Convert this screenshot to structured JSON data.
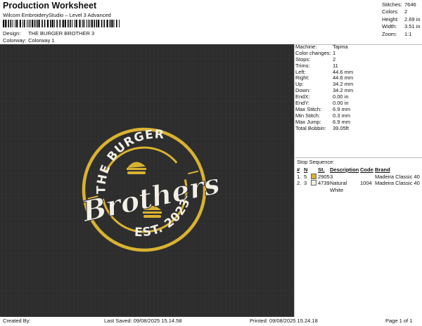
{
  "header": {
    "title": "Production Worksheet",
    "subtitle": "Wilcom EmbroideryStudio – Level 3 Advanced",
    "design_label": "Design:",
    "design_value": "THE BURGER BROTHER 3",
    "colorway_label": "Colorway:",
    "colorway_value": "Colorway 1"
  },
  "stats": [
    {
      "label": "Stitches:",
      "value": "7646"
    },
    {
      "label": "Colors:",
      "value": "2"
    },
    {
      "label": "Height:",
      "value": "2.69 in"
    },
    {
      "label": "Width:",
      "value": "3.51 in"
    },
    {
      "label": "Zoom:",
      "value": "1:1"
    }
  ],
  "machine_info": [
    {
      "label": "Machine:",
      "value": "Tajima"
    },
    {
      "label": "Color changes:",
      "value": "1"
    },
    {
      "label": "Stops:",
      "value": "2"
    },
    {
      "label": "Trims:",
      "value": "11"
    },
    {
      "label": "Left:",
      "value": "44.6 mm"
    },
    {
      "label": "Right:",
      "value": "44.6 mm"
    },
    {
      "label": "Up:",
      "value": "34.2 mm"
    },
    {
      "label": "Down:",
      "value": "34.2 mm"
    },
    {
      "label": "EndX:",
      "value": "0.00 in"
    },
    {
      "label": "EndY:",
      "value": "0.00 in"
    },
    {
      "label": "Max Stitch:",
      "value": "6.9 mm"
    },
    {
      "label": "Min Stitch:",
      "value": "0.3 mm"
    },
    {
      "label": "Max Jump:",
      "value": "6.9 mm"
    },
    {
      "label": "Total Bobbin:",
      "value": "39.05ft"
    }
  ],
  "stop_sequence": {
    "title": "Stop Sequence:",
    "headers": {
      "num": "#",
      "n": "N",
      "st": "St.",
      "description": "Description",
      "code": "Code",
      "brand": "Brand"
    },
    "rows": [
      {
        "num": "1.",
        "n": "5",
        "color": "#d9b231",
        "st": "2905",
        "description": "3",
        "code": "",
        "brand": "Madeira Classic 40"
      },
      {
        "num": "2.",
        "n": "3",
        "color": "#f2efe6",
        "st": "4739",
        "description": "Natural White",
        "code": "1004",
        "brand": "Madeira Classic 40"
      }
    ]
  },
  "artwork": {
    "top_text": "THE BURGER",
    "main_text": "Brothers",
    "bottom_text": "EST. 2023",
    "colors": {
      "background": "#2d2d2d",
      "gold": "#d9b231",
      "white": "#f2efe6"
    }
  },
  "footer": {
    "created_by": "Created By:",
    "last_saved": "Last Saved: 09/08/2025 15.14.58",
    "printed": "Printed: 09/08/2025 15.24.18",
    "page": "Page 1 of 1"
  }
}
